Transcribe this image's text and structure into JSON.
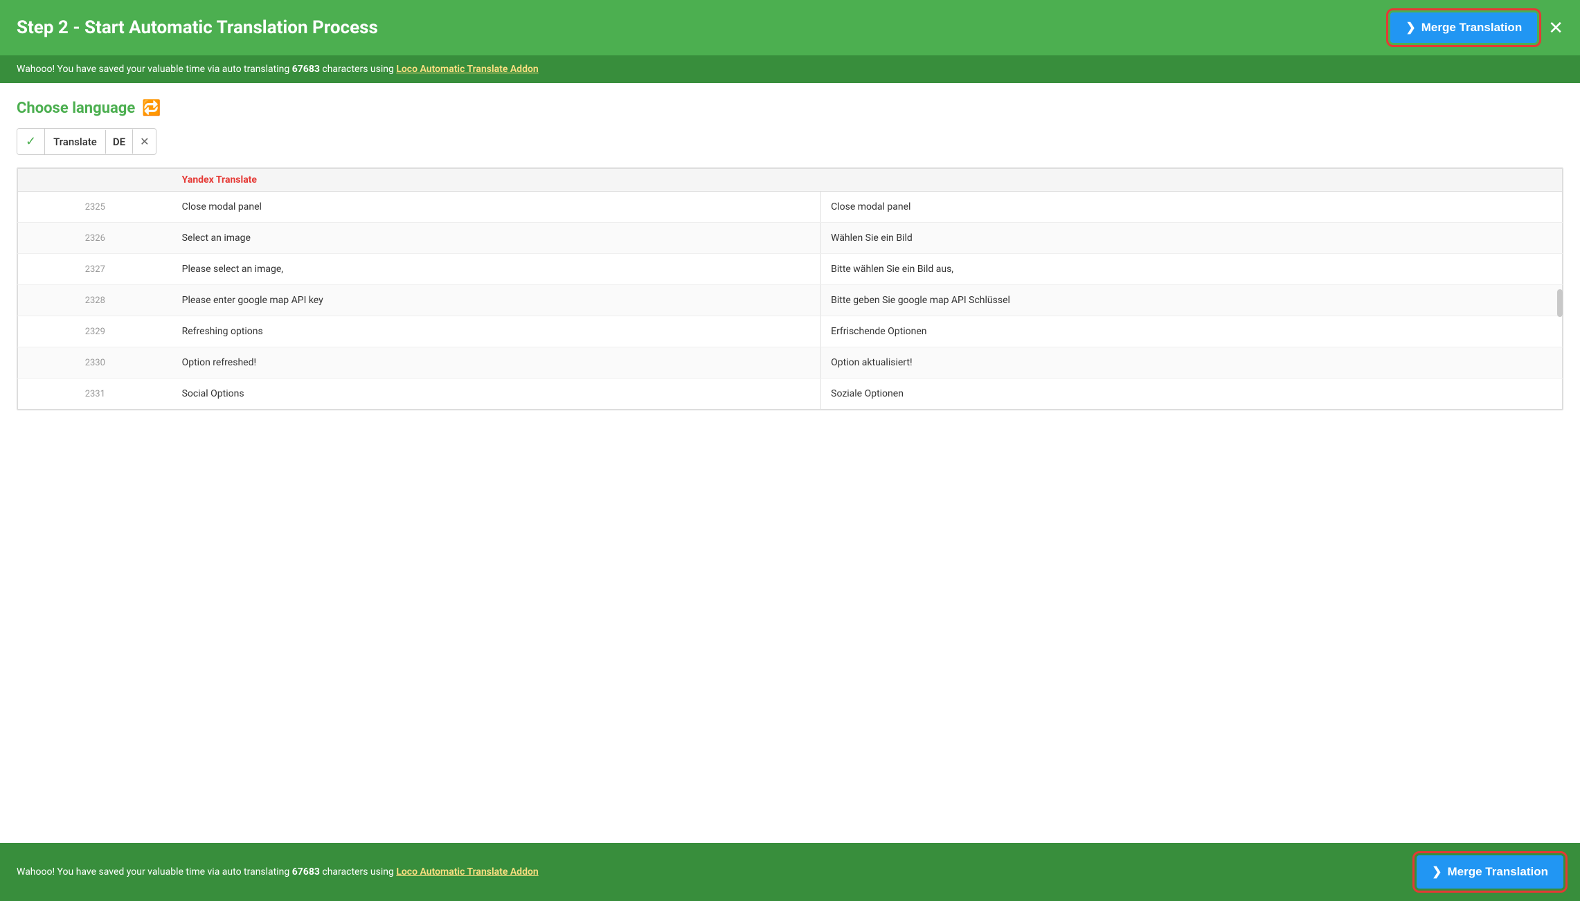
{
  "header": {
    "title": "Step 2 - Start Automatic Translation Process",
    "merge_button_label": "Merge Translation",
    "close_label": "✕"
  },
  "banner": {
    "text_before": "Wahooo! You have saved your valuable time via auto translating ",
    "characters": "67683",
    "text_middle": " characters using ",
    "link_text": "Loco Automatic Translate Addon"
  },
  "choose_language": {
    "heading": "Choose language",
    "icon_label": "🔁",
    "tag": {
      "check": "✓",
      "label": "Translate",
      "code": "DE",
      "close": "✕"
    }
  },
  "table": {
    "header_num": "",
    "header_source": "Yandex Translate",
    "header_translation": "",
    "rows": [
      {
        "num": "2325",
        "source": "Close modal panel",
        "translation": "Close modal panel"
      },
      {
        "num": "2326",
        "source": "Select an image",
        "translation": "Wählen Sie ein Bild"
      },
      {
        "num": "2327",
        "source": "Please select an image,",
        "translation": "Bitte wählen Sie ein Bild aus,"
      },
      {
        "num": "2328",
        "source": "Please enter google map API key",
        "translation": "Bitte geben Sie google map API Schlüssel"
      },
      {
        "num": "2329",
        "source": "Refreshing options",
        "translation": "Erfrischende Optionen"
      },
      {
        "num": "2330",
        "source": "Option refreshed!",
        "translation": "Option aktualisiert!"
      },
      {
        "num": "2331",
        "source": "Social Options",
        "translation": "Soziale Optionen"
      }
    ]
  },
  "footer": {
    "text_before": "Wahooo! You have saved your valuable time via auto translating ",
    "characters": "67683",
    "text_middle": " characters using ",
    "link_text": "Loco Automatic Translate Addon",
    "merge_button_label": "Merge Translation"
  },
  "icons": {
    "arrow_right": "❯"
  }
}
